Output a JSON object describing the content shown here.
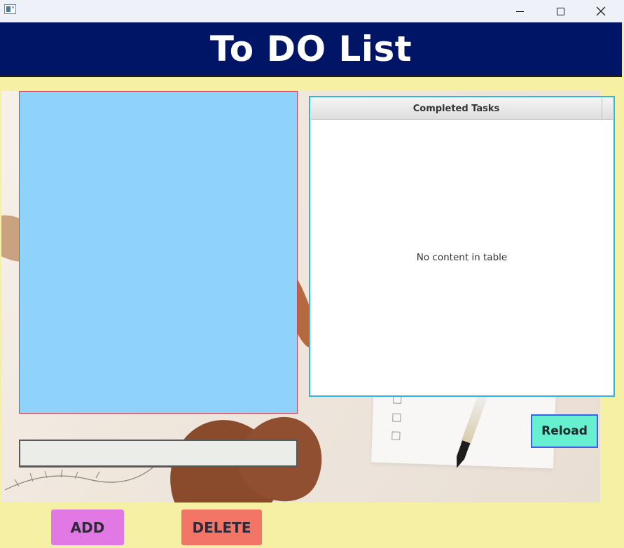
{
  "window": {
    "icon": "app-window-icon",
    "controls": [
      "minimize-icon",
      "maximize-icon",
      "close-icon"
    ]
  },
  "header": {
    "title": "To DO List",
    "background": "#001566"
  },
  "task_list": {
    "items": [],
    "background": "#8fd3fb"
  },
  "completed_table": {
    "column_header": "Completed Tasks",
    "placeholder": "No content in table",
    "rows": []
  },
  "task_input": {
    "value": "",
    "placeholder": ""
  },
  "buttons": {
    "reload": "Reload",
    "add": "ADD",
    "delete": "DELETE"
  },
  "colors": {
    "app_background": "#f5f0a3",
    "reload": "#66f0cf",
    "add": "#e278e3",
    "delete": "#f27565"
  }
}
